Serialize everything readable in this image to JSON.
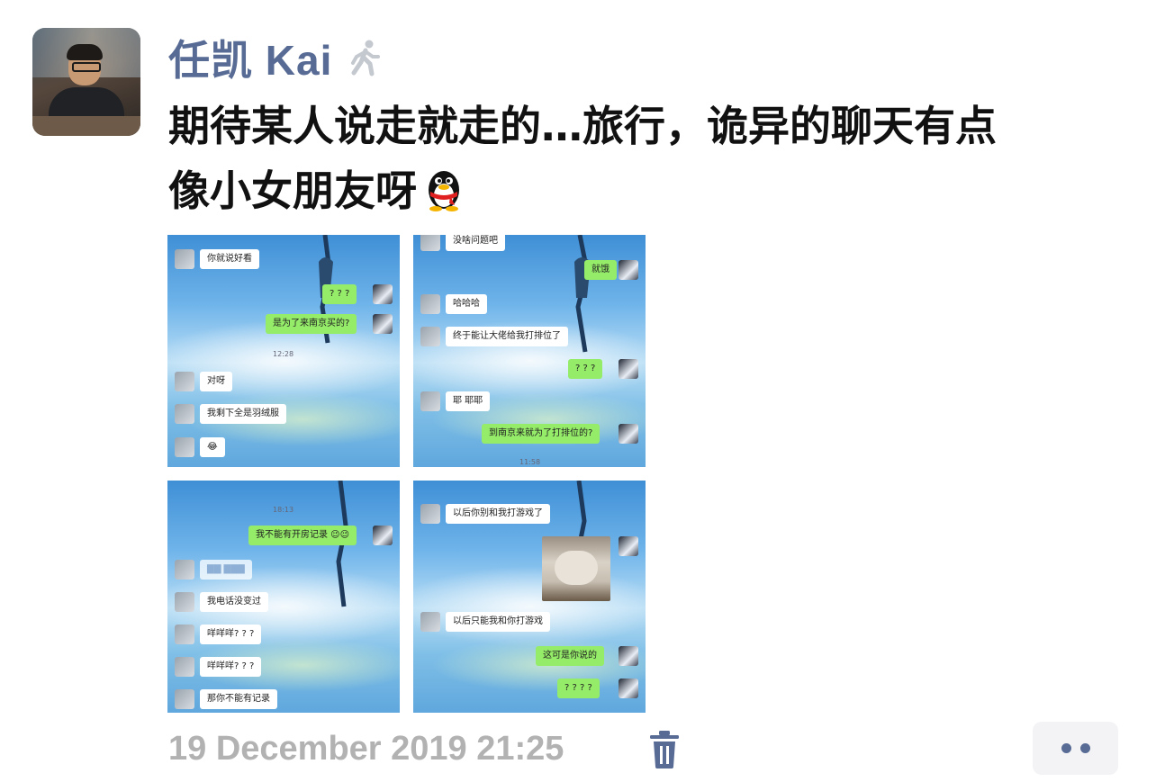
{
  "author": {
    "name": "任凯 Kai",
    "avatar_icon": "user-avatar-photo",
    "status_icon": "walking-person-icon"
  },
  "post": {
    "text_lines": [
      "期待某人说走就走的…旅行，诡异的聊天有点",
      "像小女朋友呀"
    ],
    "emoji_icon": "qq-penguin-emoji"
  },
  "images": [
    {
      "messages": [
        {
          "side": "in",
          "text": "你就说好看"
        },
        {
          "side": "out",
          "text": "? ? ?"
        },
        {
          "side": "out",
          "text": "是为了来南京买的?"
        },
        {
          "side": "time",
          "text": "12:28"
        },
        {
          "side": "in",
          "text": "对呀"
        },
        {
          "side": "in",
          "text": "我剩下全是羽绒服"
        },
        {
          "side": "in",
          "text": "😂"
        }
      ]
    },
    {
      "messages": [
        {
          "side": "in",
          "text": "没啥问题吧"
        },
        {
          "side": "out",
          "text": "就饿"
        },
        {
          "side": "in",
          "text": "哈哈哈"
        },
        {
          "side": "in",
          "text": "终于能让大佬给我打排位了"
        },
        {
          "side": "out",
          "text": "? ? ?"
        },
        {
          "side": "in",
          "text": "耶 耶耶"
        },
        {
          "side": "out",
          "text": "到南京来就为了打排位的?"
        },
        {
          "side": "time",
          "text": "11:58"
        }
      ]
    },
    {
      "messages": [
        {
          "side": "time",
          "text": "18:13"
        },
        {
          "side": "out",
          "text": "我不能有开房记录 😉😉"
        },
        {
          "side": "in",
          "text": "▇▇ ▇▇▇"
        },
        {
          "side": "in",
          "text": "我电话没变过"
        },
        {
          "side": "in",
          "text": "咩咩咩? ? ?"
        },
        {
          "side": "in",
          "text": "咩咩咩? ? ?"
        },
        {
          "side": "in",
          "text": "那你不能有记录"
        }
      ]
    },
    {
      "messages": [
        {
          "side": "in",
          "text": "以后你别和我打游戏了"
        },
        {
          "side": "in",
          "text": "以后只能我和你打游戏"
        },
        {
          "side": "out",
          "text": "这可是你说的"
        },
        {
          "side": "out",
          "text": "? ? ? ?"
        }
      ],
      "sticker_icon": "sleepy-cat-sticker"
    }
  ],
  "meta": {
    "timestamp": "19 December 2019 21:25",
    "delete_icon": "trash-icon",
    "more_icon": "more-dots-icon"
  },
  "colors": {
    "name": "#576b95",
    "timestamp": "#b2b2b2",
    "outgoing_bubble": "#95ec69"
  }
}
